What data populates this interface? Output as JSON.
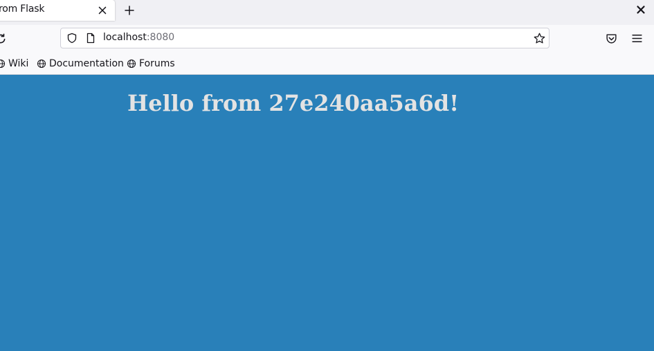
{
  "browser": {
    "tab": {
      "title": "rom Flask"
    },
    "url": {
      "host": "localhost",
      "port": ":8080"
    },
    "bookmarks": [
      {
        "label": "Wiki"
      },
      {
        "label": "Documentation"
      },
      {
        "label": "Forums"
      }
    ],
    "icons": [
      "close-icon",
      "plus-icon",
      "reload-icon",
      "shield-icon",
      "page-icon",
      "star-icon",
      "pocket-icon",
      "menu-icon",
      "globe-icon"
    ]
  },
  "page": {
    "background_color": "#2980b9",
    "heading": "Hello from 27e240aa5a6d!"
  }
}
